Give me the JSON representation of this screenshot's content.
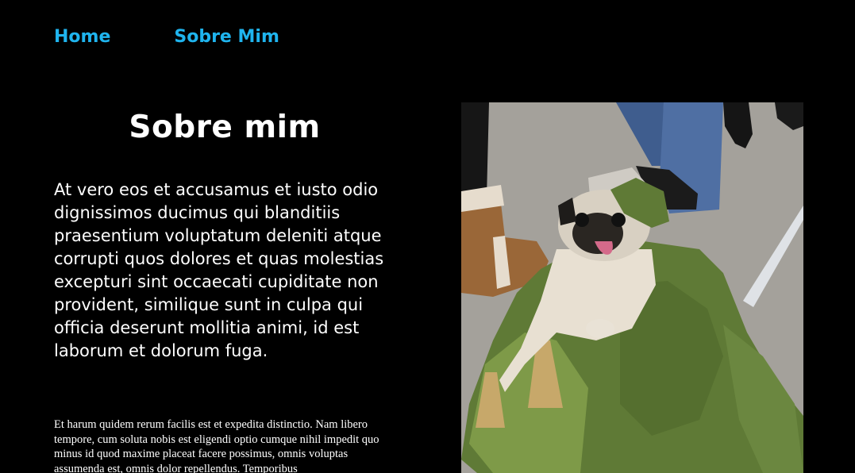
{
  "nav": {
    "items": [
      {
        "label": "Home"
      },
      {
        "label": "Sobre Mim"
      }
    ],
    "link_color": "#1fb4ee"
  },
  "main": {
    "title": "Sobre mim",
    "lead": "At vero eos et accusamus et iusto odio dignissimos ducimus qui blanditiis praesentium voluptatum deleniti atque corrupti quos dolores et quas molestias excepturi sint occaecati cupiditate non provident, similique sunt in culpa qui officia deserunt mollitia animi, id est laborum et dolorum fuga.",
    "body": "Et harum quidem rerum facilis est et expedita distinctio. Nam libero tempore, cum soluta nobis est eligendi optio cumque nihil impedit quo minus id quod maxime placeat facere possimus, omnis voluptas assumenda est, omnis dolor repellendus. Temporibus"
  },
  "photo": {
    "subject": "pug-in-green-velvet-costume"
  },
  "colors": {
    "background": "#000000",
    "text": "#ffffff",
    "accent": "#1fb4ee"
  }
}
